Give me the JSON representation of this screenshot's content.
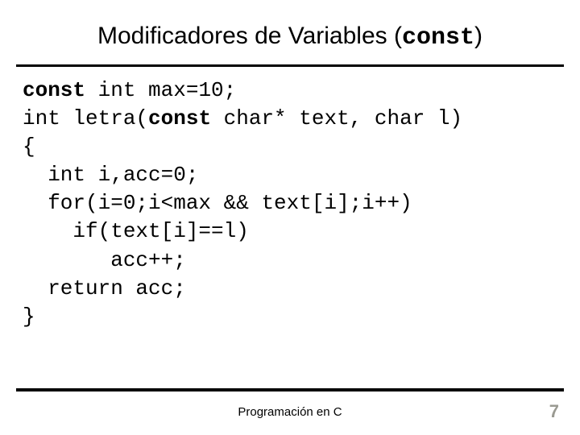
{
  "title": {
    "prefix": "Modificadores de Variables (",
    "mono": "const",
    "suffix": ")"
  },
  "code": {
    "l0_kw": "const",
    "l0_rest": " int max=10;",
    "l1_a": "int letra(",
    "l1_kw": "const",
    "l1_b": " char* text, char l)",
    "l2": "{",
    "l3": "  int i,acc=0;",
    "l4": "  for(i=0;i<max && text[i];i++)",
    "l5": "    if(text[i]==l)",
    "l6": "       acc++;",
    "l7": "  return acc;",
    "l8": "}"
  },
  "footer": {
    "center": "Programación en C",
    "page": "7"
  }
}
